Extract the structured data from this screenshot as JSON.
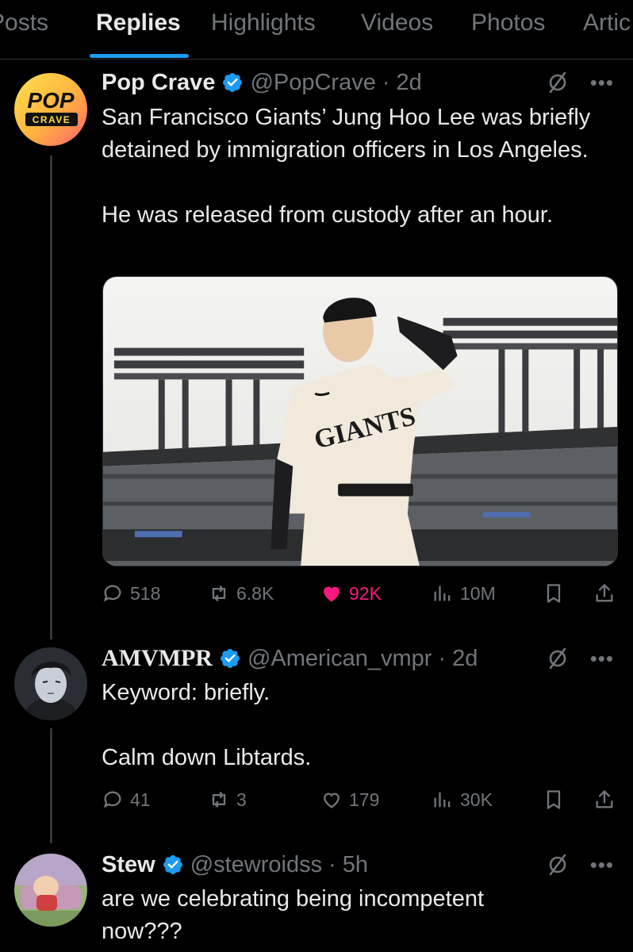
{
  "tabs": [
    {
      "label": "Posts"
    },
    {
      "label": "Replies"
    },
    {
      "label": "Highlights"
    },
    {
      "label": "Videos"
    },
    {
      "label": "Photos"
    },
    {
      "label": "Artic"
    }
  ],
  "active_tab": "Replies",
  "colors": {
    "accent": "#1d9bf0",
    "like": "#f91880",
    "muted": "#71767b",
    "verified": "#1d9bf0"
  },
  "posts": [
    {
      "name": "Pop Crave",
      "handle": "@PopCrave",
      "separator": "·",
      "time": "2d",
      "avatar_icon": "pop-crave-logo",
      "avatar_text_top": "POP",
      "avatar_text_bottom": "CRAVE",
      "text": "San Francisco Giants’ Jung Hoo Lee was briefly detained by immigration officers in Los Angeles.\n\nHe was released from custody after an hour.",
      "media_jersey_text": "GIANTS",
      "replies": "518",
      "reposts": "6.8K",
      "likes": "92K",
      "views": "10M",
      "liked": true
    },
    {
      "name": "AMVMPR",
      "handle": "@American_vmpr",
      "separator": "·",
      "time": "2d",
      "avatar_icon": "anime-avatar",
      "text": "Keyword: briefly.\n\nCalm down Libtards.",
      "replies": "41",
      "reposts": "3",
      "likes": "179",
      "views": "30K",
      "liked": false
    },
    {
      "name": "Stew",
      "handle": "@stewroidss",
      "separator": "·",
      "time": "5h",
      "avatar_icon": "cartoon-avatar",
      "text": "are we celebrating being incompetent now???"
    }
  ]
}
